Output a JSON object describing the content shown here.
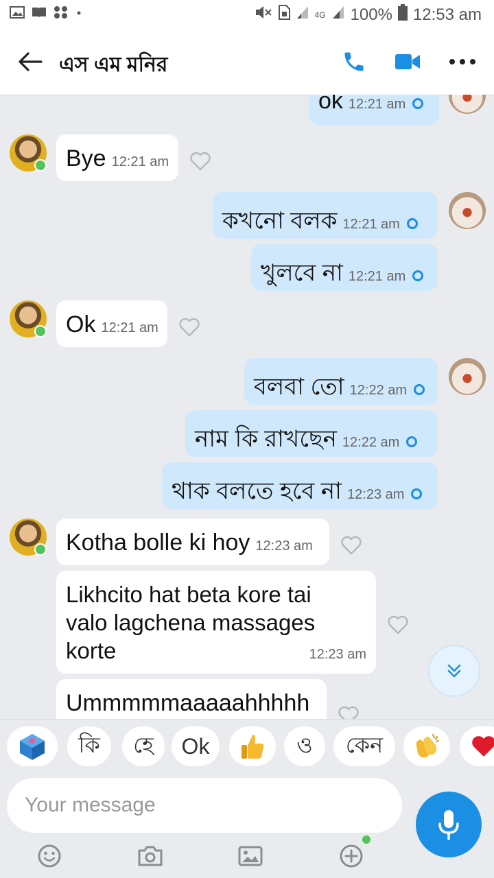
{
  "status_bar": {
    "network": "4G",
    "battery": "100%",
    "time": "12:53 am"
  },
  "header": {
    "contact_name": "এস এম মনির"
  },
  "messages": [
    {
      "dir": "out",
      "text": "ok",
      "time": "12:21 am"
    },
    {
      "dir": "in",
      "text": "Bye",
      "time": "12:21 am"
    },
    {
      "dir": "out",
      "text": "কখনো বলক",
      "time": "12:21 am"
    },
    {
      "dir": "out",
      "text": "খুলবে না",
      "time": "12:21 am"
    },
    {
      "dir": "in",
      "text": "Ok",
      "time": "12:21 am"
    },
    {
      "dir": "out",
      "text": "বলবা তো",
      "time": "12:22 am"
    },
    {
      "dir": "out",
      "text": "নাম কি রাখছেন",
      "time": "12:22 am"
    },
    {
      "dir": "out",
      "text": "থাক বলতে হবে না",
      "time": "12:23 am"
    },
    {
      "dir": "in",
      "text": "Kotha bolle ki hoy",
      "time": "12:23 am"
    },
    {
      "dir": "in",
      "lines": [
        "Likhcito hat beta kore tai",
        "valo lagchena massages",
        "korte"
      ],
      "time": "12:23 am"
    },
    {
      "dir": "in",
      "text": "Ummmmmaaaaahhhhh",
      "time": ""
    }
  ],
  "quick_replies": [
    "কি",
    "হে",
    "Ok",
    "ও",
    "কেন"
  ],
  "composer": {
    "placeholder": "Your message"
  },
  "colors": {
    "accent": "#1a8fe3",
    "outgoing_bubble": "#cfe8fc",
    "incoming_bubble": "#ffffff",
    "background": "#e9ebee",
    "online": "#55c25a"
  }
}
